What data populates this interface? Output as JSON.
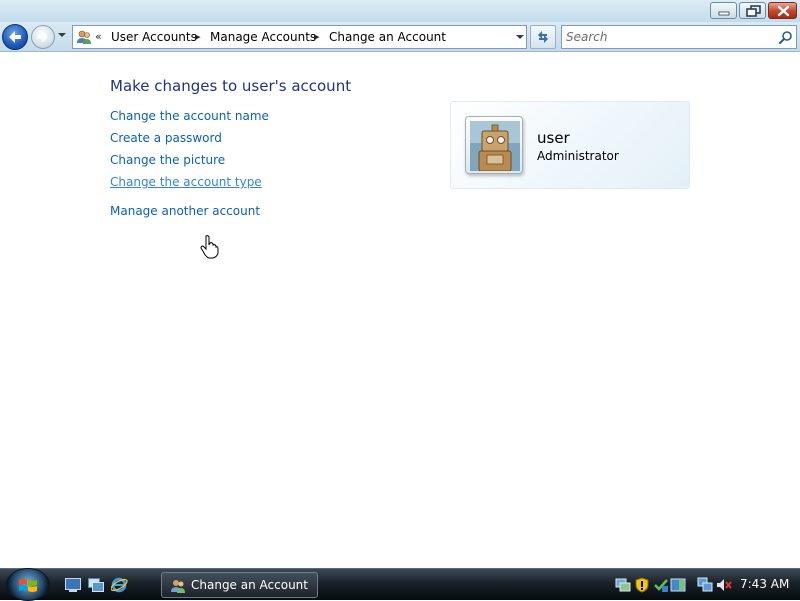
{
  "window": {
    "controls": [
      "minimize",
      "maximize",
      "close"
    ]
  },
  "nav": {
    "overflow_chevron": "«",
    "breadcrumb": [
      "User Accounts",
      "Manage Accounts",
      "Change an Account"
    ],
    "separator": "▸",
    "search_placeholder": "Search"
  },
  "main": {
    "title": "Make changes to user's account",
    "tasks": [
      "Change the account name",
      "Create a password",
      "Change the picture",
      "Change the account type",
      "Manage another account"
    ],
    "hovered_task_index": 3
  },
  "account": {
    "name": "user",
    "role": "Administrator",
    "picture_icon": "robot-picture"
  },
  "taskbar": {
    "quick_launch": [
      "show-desktop-icon",
      "switch-windows-icon",
      "internet-explorer-icon"
    ],
    "active_window": "Change an Account",
    "tray_icons": [
      "network-icon",
      "security-shield-icon",
      "update-icon",
      "sidebar-icon",
      "network-status-icon",
      "volume-muted-icon"
    ],
    "clock": "7:43 AM"
  },
  "colors": {
    "link": "#0b61b6",
    "link_hover": "#3584d8",
    "title": "#1e3287"
  }
}
